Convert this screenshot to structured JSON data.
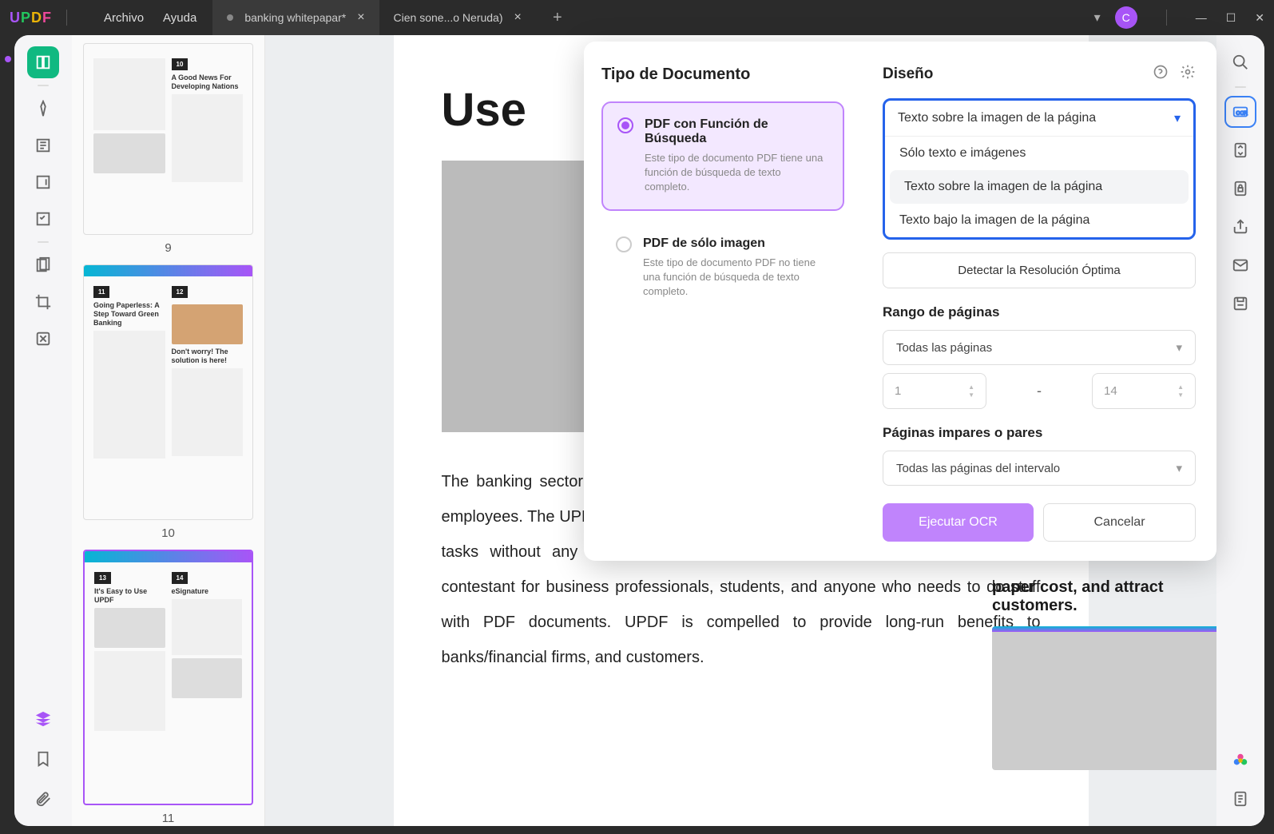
{
  "app": {
    "logo": "UPDF"
  },
  "menu": {
    "file": "Archivo",
    "help": "Ayuda"
  },
  "tabs": [
    {
      "title": "banking whitepapar*",
      "active": true
    },
    {
      "title": "Cien sone...o Neruda)",
      "active": false
    }
  ],
  "avatar": "C",
  "thumbnails": [
    {
      "num": "9",
      "badge": "10",
      "title": "A Good News For Developing Nations"
    },
    {
      "num": "10",
      "badge1": "11",
      "title1": "Going Paperless: A Step Toward Green Banking",
      "badge2": "12",
      "title2": "Don't worry! The solution is here!"
    },
    {
      "num": "11",
      "badge1": "13",
      "title1": "It's Easy to Use UPDF",
      "badge2": "14",
      "title2": "eSignature"
    }
  ],
  "document": {
    "heading": "Use",
    "body": "The banking sector spends a lot of money to buy digital productivity tools for its employees. The UPDF is the most convenient; its interface allows doing PDF-related tasks without any skills. Moreover, its flexible design features are the most contestant for business professionals, students, and anyone who needs to do stuff with PDF documents. UPDF is compelled to provide long-run benefits to banks/financial firms, and customers.",
    "right_caption": "paper cost, and attract customers."
  },
  "panel": {
    "left_title": "Tipo de Documento",
    "opt1_label": "PDF con Función de Búsqueda",
    "opt1_desc": "Este tipo de documento PDF tiene una función de búsqueda de texto completo.",
    "opt2_label": "PDF de sólo imagen",
    "opt2_desc": "Este tipo de documento PDF no tiene una función de búsqueda de texto completo.",
    "right_title": "Diseño",
    "layout_selected": "Texto sobre la imagen de la página",
    "layout_options": [
      "Sólo texto e imágenes",
      "Texto sobre la imagen de la página",
      "Texto bajo la imagen de la página"
    ],
    "detect": "Detectar la Resolución Óptima",
    "range_title": "Rango de páginas",
    "range_all": "Todas las páginas",
    "range_from": "1",
    "range_to": "14",
    "oddeven_title": "Páginas impares o pares",
    "oddeven_value": "Todas las páginas del intervalo",
    "run": "Ejecutar OCR",
    "cancel": "Cancelar"
  }
}
